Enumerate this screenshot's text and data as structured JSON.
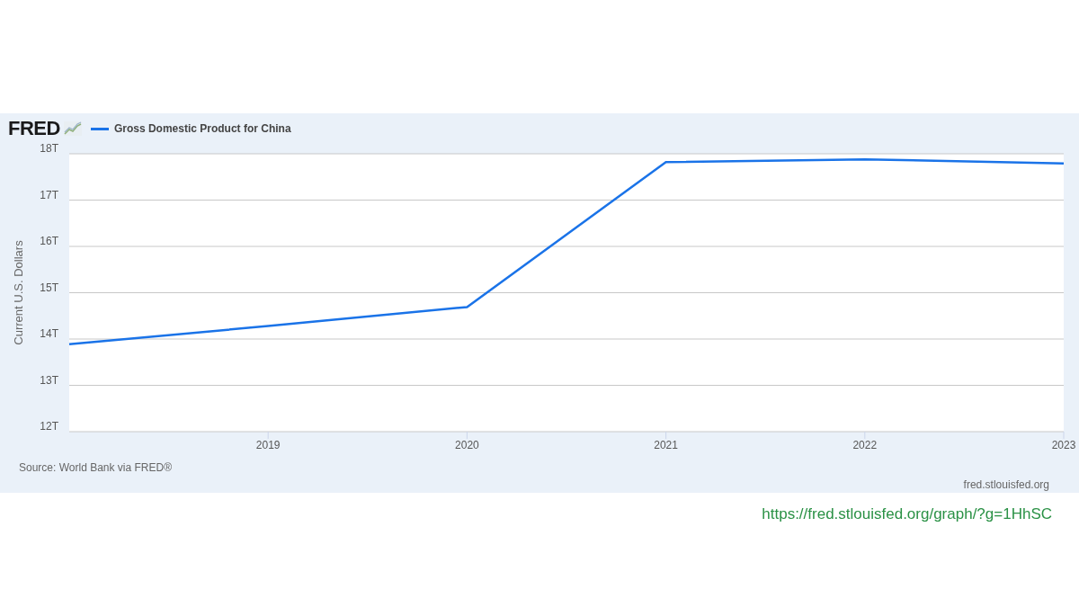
{
  "header": {
    "logo": "FRED"
  },
  "chart_data": {
    "type": "line",
    "ylabel": "Current U.S. Dollars",
    "x": [
      2018,
      2019,
      2020,
      2021,
      2022,
      2023
    ],
    "series": [
      {
        "name": "Gross Domestic Product for China",
        "color": "#1a73e8",
        "values": [
          13.89,
          14.28,
          14.69,
          17.82,
          17.88,
          17.79
        ]
      }
    ],
    "grid": true,
    "xlim": [
      2018,
      2023
    ],
    "ylim": [
      12,
      18
    ],
    "xticks": [
      2019,
      2020,
      2021,
      2022,
      2023
    ],
    "yticks": [
      {
        "value": 12,
        "label": "12T"
      },
      {
        "value": 13,
        "label": "13T"
      },
      {
        "value": 14,
        "label": "14T"
      },
      {
        "value": 15,
        "label": "15T"
      },
      {
        "value": 16,
        "label": "16T"
      },
      {
        "value": 17,
        "label": "17T"
      },
      {
        "value": 18,
        "label": "18T"
      }
    ]
  },
  "footer": {
    "source": "Source: World Bank via FRED®",
    "site": "fred.stlouisfed.org"
  },
  "link": "https://fred.stlouisfed.org/graph/?g=1HhSC"
}
